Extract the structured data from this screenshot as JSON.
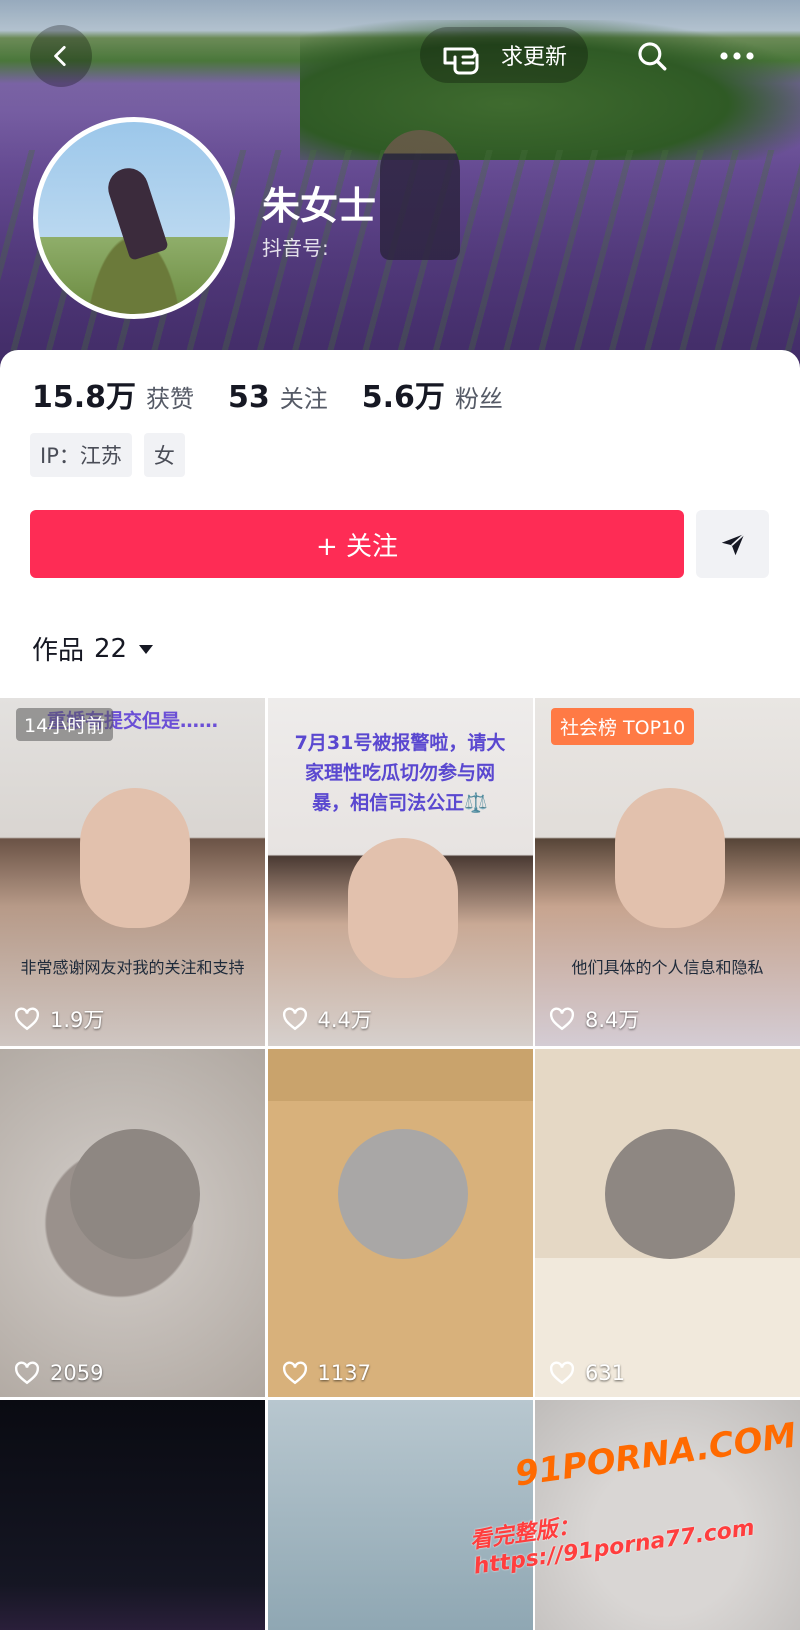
{
  "header": {
    "request_update_label": "求更新",
    "name": "朱女士",
    "douyin_id_label": "抖音号:"
  },
  "stats": [
    {
      "value": "15.8万",
      "label": "获赞"
    },
    {
      "value": "53",
      "label": "关注"
    },
    {
      "value": "5.6万",
      "label": "粉丝"
    }
  ],
  "tags": [
    "IP：江苏",
    "女"
  ],
  "actions": {
    "follow_label": "+ 关注"
  },
  "works": {
    "label": "作品",
    "count": "22"
  },
  "grid": [
    {
      "badge": "14小时前",
      "caption_top": "重婚有提交但是……",
      "subtitle": "非常感谢网友对我的关注和支持",
      "likes": "1.9万"
    },
    {
      "caption": "7月31号被报警啦，请大家理性吃瓜切勿参与网暴，相信司法公正⚖️",
      "likes": "4.4万"
    },
    {
      "badge": "社会榜 TOP10",
      "subtitle": "他们具体的个人信息和隐私",
      "likes": "8.4万"
    },
    {
      "likes": "2059"
    },
    {
      "likes": "1137"
    },
    {
      "likes": "631"
    },
    {},
    {},
    {}
  ],
  "watermark": {
    "line1": "91PORNA.COM",
    "line2": "看完整版：https://91porna77.com"
  },
  "colors": {
    "accent": "#fe2c55",
    "badge_top": "#ff7a45"
  }
}
